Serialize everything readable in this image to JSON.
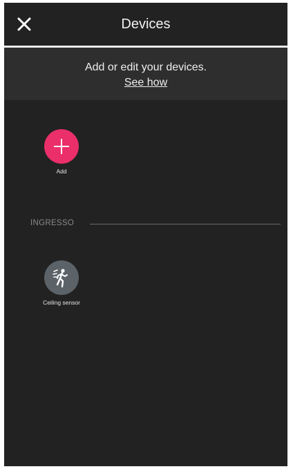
{
  "header": {
    "close_icon": "close-icon",
    "title": "Devices"
  },
  "banner": {
    "text": "Add or edit your devices.",
    "link": "See how"
  },
  "add_tile": {
    "label": "Add",
    "icon": "plus-icon",
    "color": "#ea2f6b"
  },
  "section": {
    "label": "INGRESSO"
  },
  "devices": [
    {
      "label": "Ceiling sensor",
      "icon": "motion-sensor-icon",
      "color": "#5b6369"
    }
  ],
  "colors": {
    "background": "#222222",
    "accent": "#ea2f6b"
  }
}
